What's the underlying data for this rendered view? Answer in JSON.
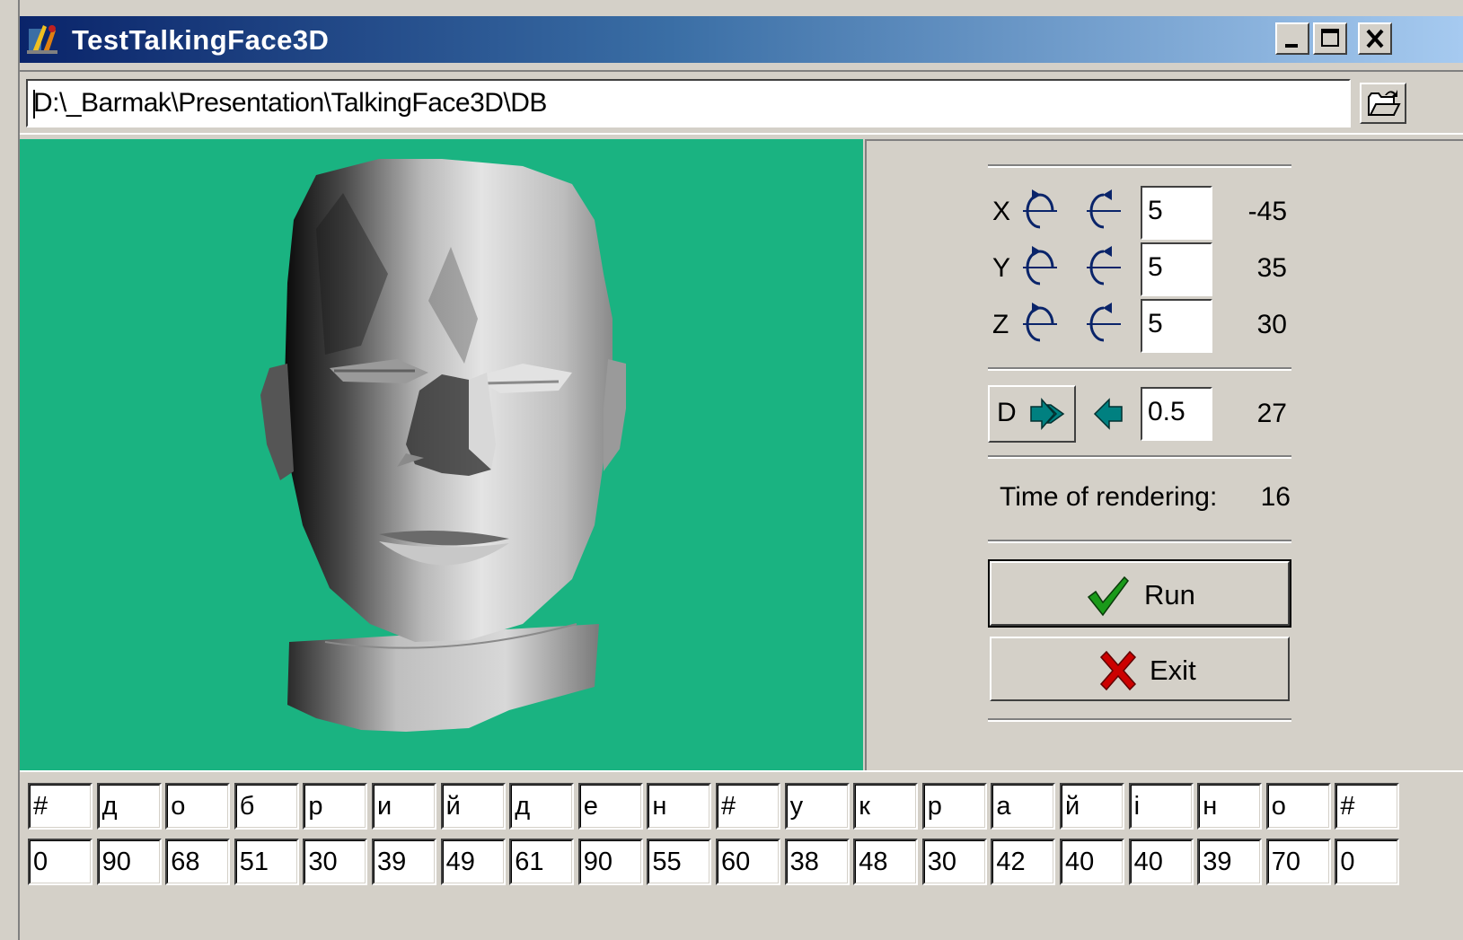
{
  "window": {
    "title": "TestTalkingFace3D"
  },
  "path": {
    "value": "D:\\_Barmak\\Presentation\\TalkingFace3D\\DB"
  },
  "rotation": [
    {
      "axis": "X",
      "step": "5",
      "value": "-45"
    },
    {
      "axis": "Y",
      "step": "5",
      "value": "35"
    },
    {
      "axis": "Z",
      "step": "5",
      "value": "30"
    }
  ],
  "distance": {
    "label": "D",
    "step": "0.5",
    "value": "27"
  },
  "render": {
    "label": "Time of rendering:",
    "value": "16"
  },
  "buttons": {
    "run": "Run",
    "exit": "Exit"
  },
  "phonemes": [
    "#",
    "д",
    "о",
    "б",
    "р",
    "и",
    "й",
    "д",
    "е",
    "н",
    "#",
    "у",
    "к",
    "р",
    "а",
    "й",
    "і",
    "н",
    "о",
    "#"
  ],
  "durations": [
    "0",
    "90",
    "68",
    "51",
    "30",
    "39",
    "49",
    "61",
    "90",
    "55",
    "60",
    "38",
    "48",
    "30",
    "42",
    "40",
    "40",
    "39",
    "70",
    "0"
  ],
  "colors": {
    "viewport_bg": "#1ab381",
    "titlebar_start": "#0a246a",
    "titlebar_end": "#a6caf0",
    "face": "#c8c8c8",
    "arrow_teal": "#008080",
    "check_green": "#1a9a1a",
    "exit_red": "#cc0000"
  }
}
